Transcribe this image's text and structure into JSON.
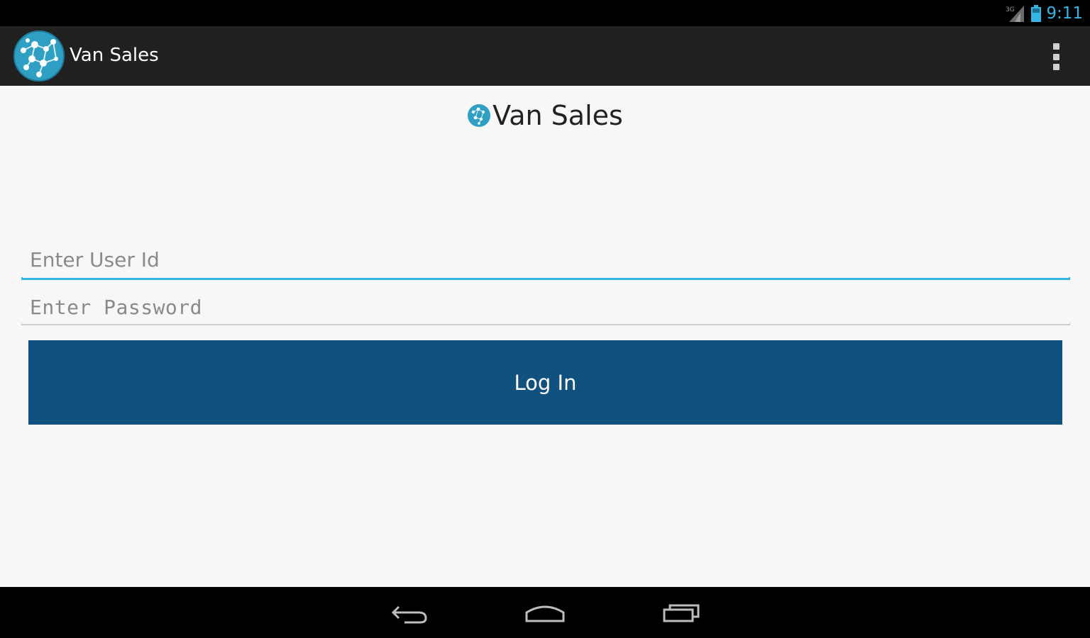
{
  "status_bar": {
    "time": "9:11",
    "network_label": "3G",
    "icons": [
      "signal-icon",
      "battery-icon"
    ]
  },
  "action_bar": {
    "title": "Van Sales",
    "logo_icon": "globe-network-logo-icon",
    "menu_icon": "overflow-menu-icon"
  },
  "login": {
    "brand_text": "Van Sales",
    "user_id_placeholder": "Enter User Id",
    "user_id_value": "",
    "password_placeholder": "Enter Password",
    "password_value": "",
    "login_button_label": "Log In"
  },
  "nav_bar": {
    "icons": [
      "back-icon",
      "home-icon",
      "recents-icon"
    ]
  },
  "colors": {
    "accent": "#33b5e5",
    "button_primary": "#115180",
    "action_bar_bg": "#212121",
    "content_bg": "#f7f7f7"
  }
}
